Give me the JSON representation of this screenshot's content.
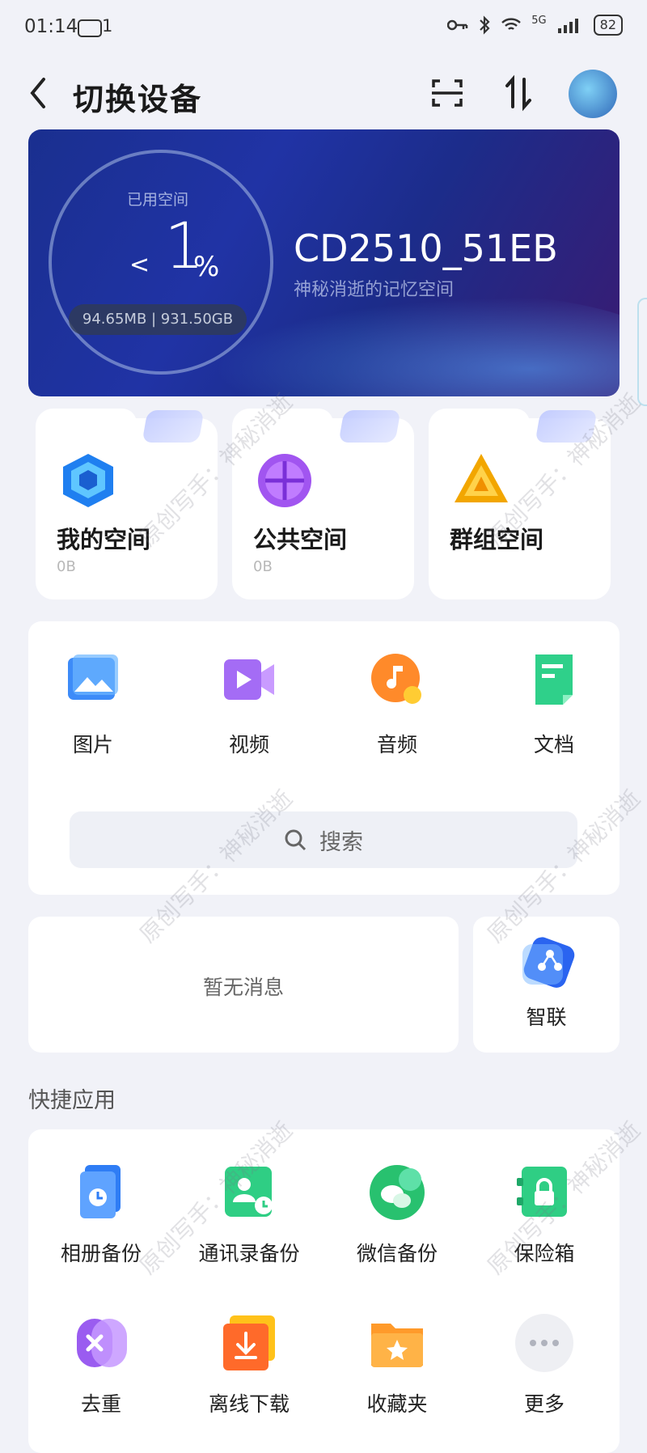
{
  "status": {
    "time": "01:14",
    "msg_count": "1",
    "network": "5G",
    "battery": "82"
  },
  "header": {
    "title": "切换设备"
  },
  "storage": {
    "used_label": "已用空间",
    "used_prefix": "<",
    "used_percent": "1",
    "percent_sign": "%",
    "capacity": "94.65MB | 931.50GB",
    "device_name": "CD2510_51EB",
    "device_subtitle": "神秘消逝的记忆空间"
  },
  "spaces": [
    {
      "name": "我的空间",
      "size": "0B"
    },
    {
      "name": "公共空间",
      "size": "0B"
    },
    {
      "name": "群组空间",
      "size": ""
    }
  ],
  "media": [
    {
      "label": "图片"
    },
    {
      "label": "视频"
    },
    {
      "label": "音频"
    },
    {
      "label": "文档"
    }
  ],
  "search": {
    "label": "搜索"
  },
  "notice": {
    "empty_text": "暂无消息"
  },
  "zhilian": {
    "label": "智联"
  },
  "quick_apps": {
    "title": "快捷应用",
    "items": [
      {
        "label": "相册备份"
      },
      {
        "label": "通讯录备份"
      },
      {
        "label": "微信备份"
      },
      {
        "label": "保险箱"
      },
      {
        "label": "去重"
      },
      {
        "label": "离线下载"
      },
      {
        "label": "收藏夹"
      },
      {
        "label": "更多"
      }
    ]
  },
  "watermark": "原创写手：神秘消逝"
}
